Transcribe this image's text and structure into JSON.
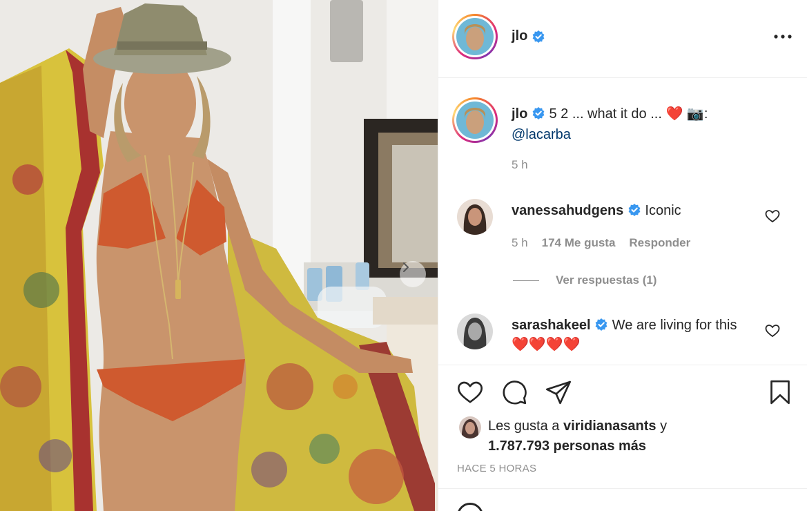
{
  "photo": {
    "alt_subject": "woman-in-bikini-photo"
  },
  "header": {
    "username": "jlo",
    "verified_icon": "verified-badge-icon",
    "more_icon": "more-options-icon"
  },
  "caption": {
    "username": "jlo",
    "text": "5 2 ... what it do ...",
    "emoji_heart": "❤️",
    "emoji_camera": "📷",
    "colon": ":",
    "mention": "@lacarba",
    "time": "5 h"
  },
  "comments": [
    {
      "username": "vanessahudgens",
      "text": "Iconic",
      "time": "5 h",
      "likes": "174 Me gusta",
      "reply": "Responder",
      "view_replies": "Ver respuestas (1)"
    },
    {
      "username": "sarashakeel",
      "text": "We are living for this",
      "emoji": "❤️❤️❤️❤️"
    }
  ],
  "actions": {
    "like_icon": "heart-icon",
    "comment_icon": "comment-icon",
    "share_icon": "share-icon",
    "save_icon": "bookmark-icon"
  },
  "likes": {
    "prefix": "Les gusta a",
    "user": "viridianasants",
    "suffix": "y",
    "count": "1.787.793 personas más"
  },
  "posted_time": "HACE 5 HORAS",
  "colors": {
    "verified": "#3897f0",
    "mention": "#00376b",
    "muted": "#8e8e8e",
    "heart_red": "#ed4956"
  }
}
